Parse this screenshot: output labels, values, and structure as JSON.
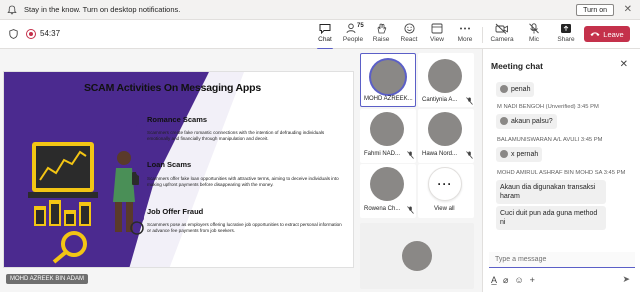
{
  "notification": {
    "message": "Stay in the know. Turn on desktop notifications.",
    "turn_on": "Turn on",
    "close": "✕"
  },
  "toolbar": {
    "timer": "54:37",
    "chat": "Chat",
    "people": "People",
    "people_count": "75",
    "raise": "Raise",
    "react": "React",
    "view": "View",
    "more": "More",
    "camera": "Camera",
    "mic": "Mic",
    "share": "Share",
    "leave": "Leave"
  },
  "slide": {
    "title": "SCAM Activities On Messaging Apps",
    "sections": [
      {
        "heading": "Romance Scams",
        "text": "Scammers create fake romantic connections with the intention of defrauding individuals emotionally and financially through manipulation and deceit."
      },
      {
        "heading": "Loan Scams",
        "text": "Scammers offer fake loan opportunities with attractive terms, aiming to deceive individuals into making upfront payments before disappearing with the money."
      },
      {
        "heading": "Job Offer Fraud",
        "text": "Scammers pose as employers offering lucrative job opportunities to extract personal information or advance fee payments from job seekers."
      }
    ],
    "presenter": "MOHD AZREEK BIN ADAM"
  },
  "participants": [
    {
      "name": "MOHD AZREEK..."
    },
    {
      "name": "Cantiynia A..."
    },
    {
      "name": "Fahmi NAD..."
    },
    {
      "name": "Hawa Nord..."
    },
    {
      "name": "Rowena Ch..."
    }
  ],
  "view_all": "View all",
  "chat": {
    "title": "Meeting chat",
    "messages": [
      {
        "meta": "",
        "text": "penah"
      },
      {
        "meta": "M NADI BENGOH (Unverified)  3:45 PM",
        "text": "akaun palsu?"
      },
      {
        "meta": "BALAMUNISWARAN A/L AVULI  3:45 PM",
        "text": "x pernah"
      },
      {
        "meta": "MOHD AMIRUL ASHRAF BIN MOHD SA  3:45 PM",
        "text": "Akaun dia digunakan transaksi haram"
      },
      {
        "meta": "",
        "text": "Cuci duit pun ada guna method ni"
      }
    ],
    "placeholder": "Type a message"
  },
  "colors": {
    "accent": "#5b5fc7",
    "leave": "#c4314b",
    "slide_purple": "#4b2a8f",
    "slide_yellow": "#f3c514"
  }
}
